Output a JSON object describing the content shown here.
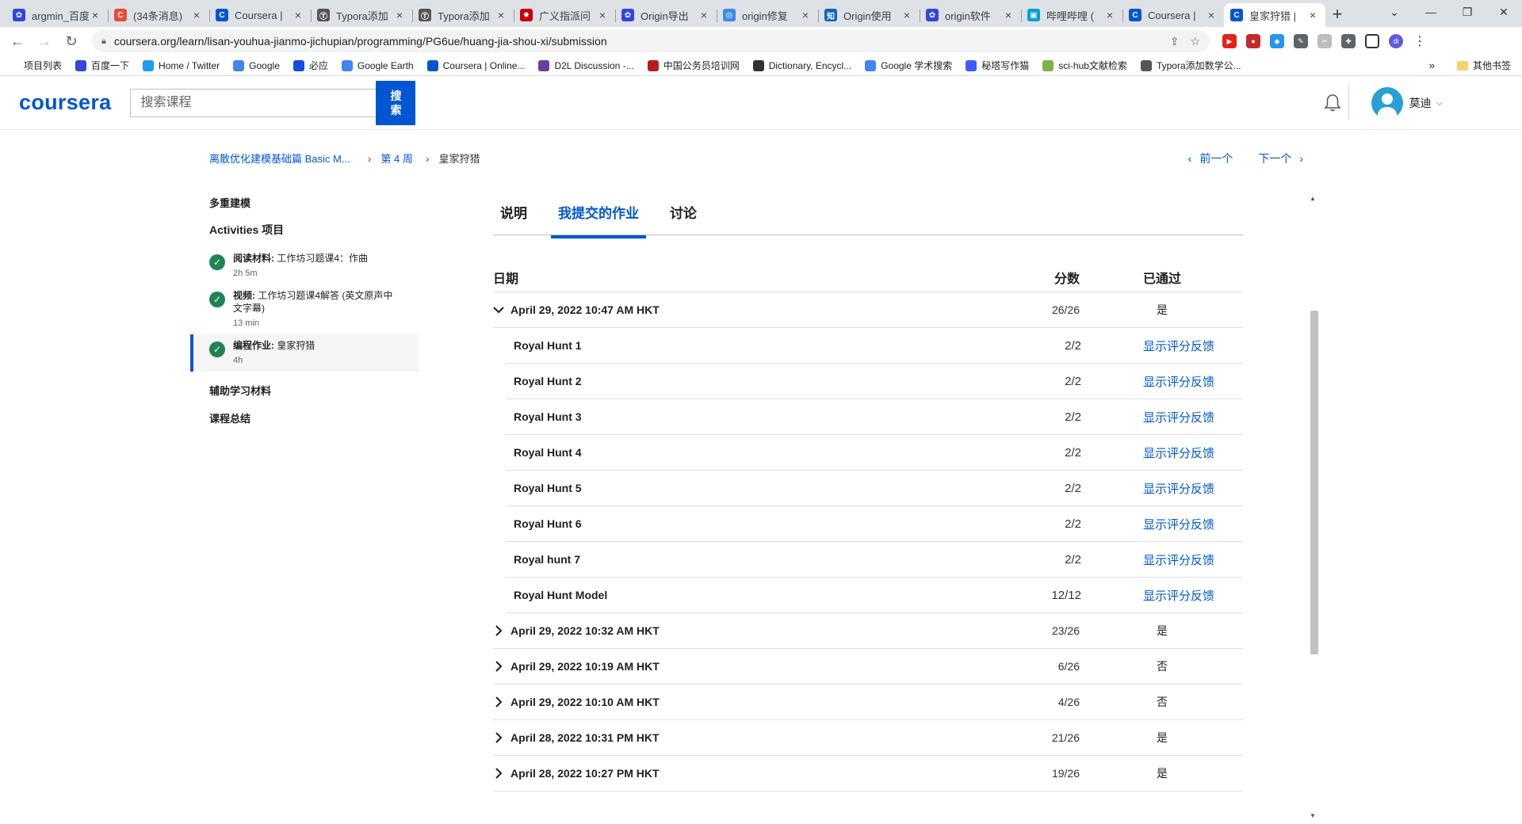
{
  "browser": {
    "tabs": [
      {
        "title": "argmin_百度",
        "color": "#3245df",
        "glyph": "✿"
      },
      {
        "title": "(34条消息)",
        "color": "#e84b3c",
        "glyph": "C"
      },
      {
        "title": "Coursera |",
        "color": "#0056d2",
        "glyph": "C"
      },
      {
        "title": "Typora添加",
        "color": "#555555",
        "glyph": "Ⓣ"
      },
      {
        "title": "Typora添加",
        "color": "#555555",
        "glyph": "Ⓣ"
      },
      {
        "title": "广义指派问",
        "color": "#c7000b",
        "glyph": "✸"
      },
      {
        "title": "Origin导出",
        "color": "#3245df",
        "glyph": "✿"
      },
      {
        "title": "origin修复",
        "color": "#3c8be8",
        "glyph": "◎"
      },
      {
        "title": "Origin使用",
        "color": "#0a66c2",
        "glyph": "知"
      },
      {
        "title": "origin软件",
        "color": "#3245df",
        "glyph": "✿"
      },
      {
        "title": "哔哩哔哩 (",
        "color": "#00a1d6",
        "glyph": "▣"
      },
      {
        "title": "Coursera |",
        "color": "#0056d2",
        "glyph": "C"
      },
      {
        "title": "皇家狩猎 |",
        "color": "#0056d2",
        "glyph": "C",
        "active": true
      }
    ],
    "url": "coursera.org/learn/lisan-youhua-jianmo-jichupian/programming/PG6ue/huang-jia-shou-xi/submission",
    "bookmarks": [
      {
        "label": "项目列表",
        "color": ""
      },
      {
        "label": "百度一下",
        "color": "#3245df"
      },
      {
        "label": "Home / Twitter",
        "color": "#1d9bf0"
      },
      {
        "label": "Google",
        "color": "#4285f4"
      },
      {
        "label": "必应",
        "color": "#174ae4"
      },
      {
        "label": "Google Earth",
        "color": "#4285f4"
      },
      {
        "label": "Coursera | Online...",
        "color": "#0056d2"
      },
      {
        "label": "D2L Discussion -...",
        "color": "#6b3fa0"
      },
      {
        "label": "中国公务员培训网",
        "color": "#b71c1c"
      },
      {
        "label": "Dictionary, Encycl...",
        "color": "#333333"
      },
      {
        "label": "Google 学术搜索",
        "color": "#4285f4"
      },
      {
        "label": "秘塔写作猫",
        "color": "#3d5afe"
      },
      {
        "label": "sci-hub文献检索",
        "color": "#7cb342"
      },
      {
        "label": "Typora添加数学公...",
        "color": "#555555"
      }
    ],
    "bookmarks_more": "»",
    "other_bookmarks": "其他书签"
  },
  "header": {
    "logo": "coursera",
    "search_placeholder": "搜索课程",
    "search_button": "搜索",
    "user_name": "莫迪"
  },
  "breadcrumb": {
    "course": "离散优化建模基础篇 Basic M...",
    "week": "第 4 周",
    "current": "皇家狩猎"
  },
  "pager": {
    "prev": "前一个",
    "next": "下一个"
  },
  "sidebar": {
    "module": "多重建模",
    "activities_title": "Activities 项目",
    "items": [
      {
        "type": "阅读材料:",
        "title": "工作坊习题课4：作曲",
        "meta": "2h 5m"
      },
      {
        "type": "视频:",
        "title": "工作坊习题课4解答 (英文原声中文字幕)",
        "meta": "13 min"
      },
      {
        "type": "编程作业:",
        "title": "皇家狩猎",
        "meta": "4h"
      }
    ],
    "links": [
      "辅助学习材料",
      "课程总结"
    ]
  },
  "tabs": [
    "说明",
    "我提交的作业",
    "讨论"
  ],
  "table": {
    "headers": {
      "date": "日期",
      "score": "分数",
      "passed": "已通过"
    },
    "feedback_label": "显示评分反馈",
    "expanded": {
      "date": "April 29, 2022 10:47 AM HKT",
      "score": "26/26",
      "passed": "是",
      "parts": [
        {
          "name": "Royal Hunt 1",
          "score": "2/2"
        },
        {
          "name": "Royal Hunt 2",
          "score": "2/2"
        },
        {
          "name": "Royal Hunt 3",
          "score": "2/2"
        },
        {
          "name": "Royal Hunt 4",
          "score": "2/2"
        },
        {
          "name": "Royal Hunt 5",
          "score": "2/2"
        },
        {
          "name": "Royal Hunt 6",
          "score": "2/2"
        },
        {
          "name": "Royal hunt 7",
          "score": "2/2"
        },
        {
          "name": "Royal Hunt Model",
          "score": "12/12"
        }
      ]
    },
    "collapsed": [
      {
        "date": "April 29, 2022 10:32 AM HKT",
        "score": "23/26",
        "passed": "是"
      },
      {
        "date": "April 29, 2022 10:19 AM HKT",
        "score": "6/26",
        "passed": "否"
      },
      {
        "date": "April 29, 2022 10:10 AM HKT",
        "score": "4/26",
        "passed": "否"
      },
      {
        "date": "April 28, 2022 10:31 PM HKT",
        "score": "21/26",
        "passed": "是"
      },
      {
        "date": "April 28, 2022 10:27 PM HKT",
        "score": "19/26",
        "passed": "是"
      }
    ]
  }
}
